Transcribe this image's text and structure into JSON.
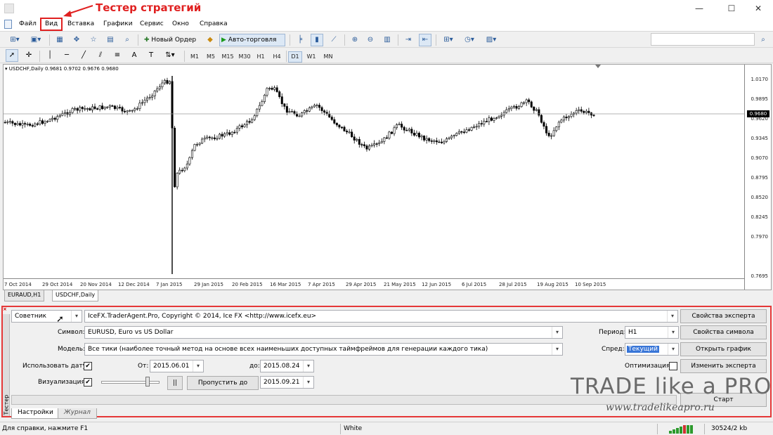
{
  "annotation": {
    "label": "Тестер стратегий"
  },
  "menu": [
    "Файл",
    "Вид",
    "Вставка",
    "Графики",
    "Сервис",
    "Окно",
    "Справка"
  ],
  "window_controls": {
    "minimize": "—",
    "maximize": "☐",
    "close": "✕"
  },
  "toolbar": {
    "new_order_label": "Новый Ордер",
    "autotrade_label": "Авто-торговля",
    "timeframes": [
      "M1",
      "M5",
      "M15",
      "M30",
      "H1",
      "H4",
      "D1",
      "W1",
      "MN"
    ],
    "active_timeframe": "D1"
  },
  "chart": {
    "symbol_header": "USDCHF,Daily  0.9681 0.9702 0.9676 0.9680",
    "current_price": "0.9680",
    "y_ticks": [
      "1.0170",
      "0.9895",
      "0.9620",
      "0.9345",
      "0.9070",
      "0.8795",
      "0.8520",
      "0.8245",
      "0.7970",
      "0.7695"
    ],
    "x_ticks": [
      "7 Oct 2014",
      "29 Oct 2014",
      "20 Nov 2014",
      "12 Dec 2014",
      "7 Jan 2015",
      "29 Jan 2015",
      "20 Feb 2015",
      "16 Mar 2015",
      "7 Apr 2015",
      "29 Apr 2015",
      "21 May 2015",
      "12 Jun 2015",
      "6 Jul 2015",
      "28 Jul 2015",
      "19 Aug 2015",
      "10 Sep 2015"
    ],
    "tabs": [
      "EURAUD,H1",
      "USDCHF,Daily"
    ],
    "active_tab": "USDCHF,Daily"
  },
  "tester": {
    "type_combo": "Советник",
    "expert_combo": "IceFX.TraderAgent.Pro, Copyright © 2014, Ice FX <http://www.icefx.eu>",
    "symbol_label": "Символ:",
    "symbol_value": "EURUSD, Euro vs US Dollar",
    "model_label": "Модель:",
    "model_value": "Все тики (наиболее точный метод на основе всех наименьших доступных таймфреймов для генерации каждого тика)",
    "use_date_label": "Использовать дату",
    "use_date_checked": "✔",
    "from_label": "От:",
    "from_value": "2015.06.01",
    "to_label": "до:",
    "to_value": "2015.08.24",
    "visualization_label": "Визуализация",
    "visualization_checked": "✔",
    "pause_label": "||",
    "skip_to_label": "Пропустить до",
    "skip_to_value": "2015.09.21",
    "period_label": "Период:",
    "period_value": "H1",
    "spread_label": "Спред:",
    "spread_value": "Текущий",
    "optimization_label": "Оптимизация",
    "btn_expert_props": "Свойства эксперта",
    "btn_symbol_props": "Свойства символа",
    "btn_open_chart": "Открыть график",
    "btn_edit_expert": "Изменить эксперта",
    "btn_start": "Старт",
    "side_label": "Тестер",
    "tabs": [
      "Настройки",
      "Журнал"
    ]
  },
  "statusbar": {
    "help": "Для справки, нажмите F1",
    "profile": "White",
    "traffic": "30524/2 kb"
  },
  "watermark": {
    "brand": "TRADE like a PRO",
    "url": "www.tradelikeapro.ru"
  },
  "colors": {
    "annotation": "#e02020",
    "tester_border": "#e53838",
    "candle": "#000000",
    "chart_bg": "#ffffff"
  }
}
